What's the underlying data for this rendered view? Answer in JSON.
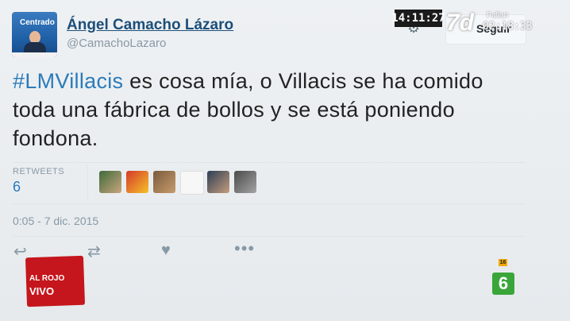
{
  "user": {
    "name": "Ángel Camacho Lázaro",
    "handle": "@CamachoLazaro",
    "avatar_text": "Centrado"
  },
  "follow_button": {
    "label": "Seguir"
  },
  "tweet": {
    "hashtag": "#LMVillacis",
    "text": " es cosa mía, o Villacis se ha comido toda una fábrica de bollos y se está poniendo fondona.",
    "retweets_label": "RETWEETS",
    "retweets_count": "6",
    "timestamp": "0:05 - 7 dic. 2015"
  },
  "icons": {
    "reply": "reply-icon",
    "retweet": "retweet-icon",
    "like": "heart-icon",
    "more": "more-icon",
    "settings": "gear-icon"
  },
  "tv_overlay": {
    "clock": "14:11:27",
    "channel_short": "7d",
    "fallan_label": "Fallan",
    "fallan_value": "02:18:33",
    "program_line1": "AL ROJO",
    "program_line2": "VIVO",
    "age_rating": "16",
    "channel_number": "6"
  },
  "colors": {
    "link": "#2b7bb9",
    "name": "#1d4e79",
    "muted": "#8899a6",
    "program_red": "#c4161c",
    "channel_green": "#3aa63a"
  }
}
